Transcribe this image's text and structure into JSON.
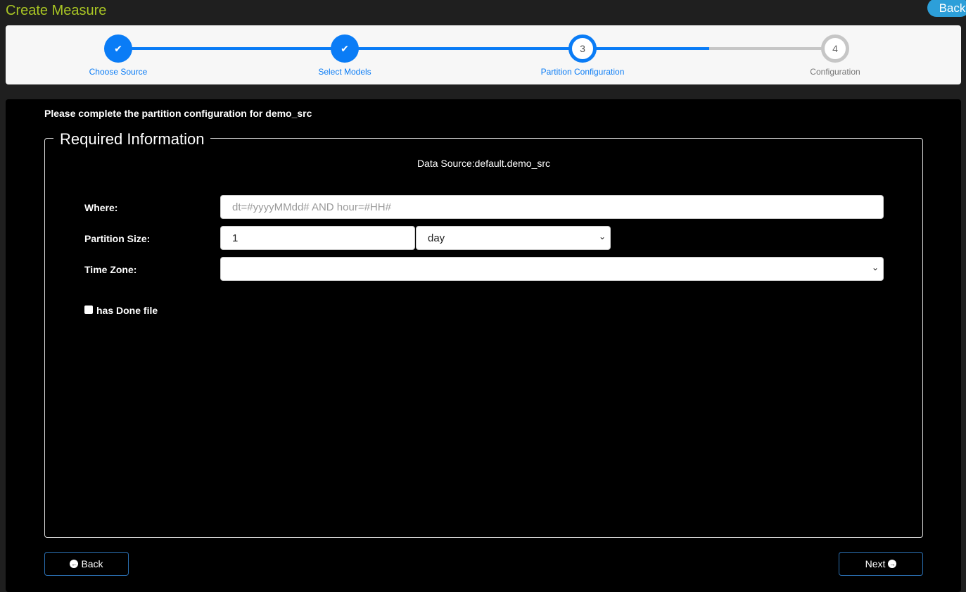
{
  "header": {
    "title": "Create Measure",
    "back_label": "Back"
  },
  "stepper": {
    "steps": [
      {
        "label": "Choose Source",
        "state": "done",
        "number": "1"
      },
      {
        "label": "Select Models",
        "state": "done",
        "number": "2"
      },
      {
        "label": "Partition Configuration",
        "state": "current",
        "number": "3"
      },
      {
        "label": "Configuration",
        "state": "todo",
        "number": "4"
      }
    ],
    "accent": "#0a7cf6",
    "inactive": "#c6c6c6"
  },
  "form": {
    "intro": "Please complete the partition configuration for demo_src",
    "legend": "Required Information",
    "data_source": "Data Source:default.demo_src",
    "where_label": "Where:",
    "where_placeholder": "dt=#yyyyMMdd# AND hour=#HH#",
    "partition_size_label": "Partition Size:",
    "partition_size_value": "1",
    "partition_unit": "day",
    "time_zone_label": "Time Zone:",
    "time_zone_value": "",
    "done_file_label": "has Done file",
    "done_file_checked": false
  },
  "footer": {
    "back_label": "Back",
    "next_label": "Next"
  }
}
